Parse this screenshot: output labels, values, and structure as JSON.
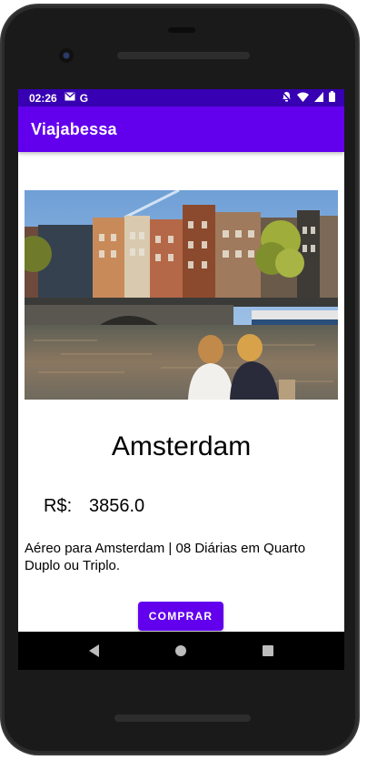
{
  "status_bar": {
    "time": "02:26",
    "icons_left": [
      "mail-icon",
      "google-icon"
    ],
    "icons_right": [
      "bell-off-icon",
      "wifi-icon",
      "signal-icon",
      "battery-icon"
    ]
  },
  "app_bar": {
    "title": "Viajabessa"
  },
  "package": {
    "image_alt": "Amsterdam canal with two people sitting by the water",
    "title": "Amsterdam",
    "currency": "R$:",
    "price": "3856.0",
    "description": "Aéreo para Amsterdam | 08 Diárias em Quarto Duplo ou Triplo.",
    "buy_label": "COMPRAR"
  },
  "colors": {
    "primary": "#6200ee",
    "primary_dark": "#3700b3"
  }
}
